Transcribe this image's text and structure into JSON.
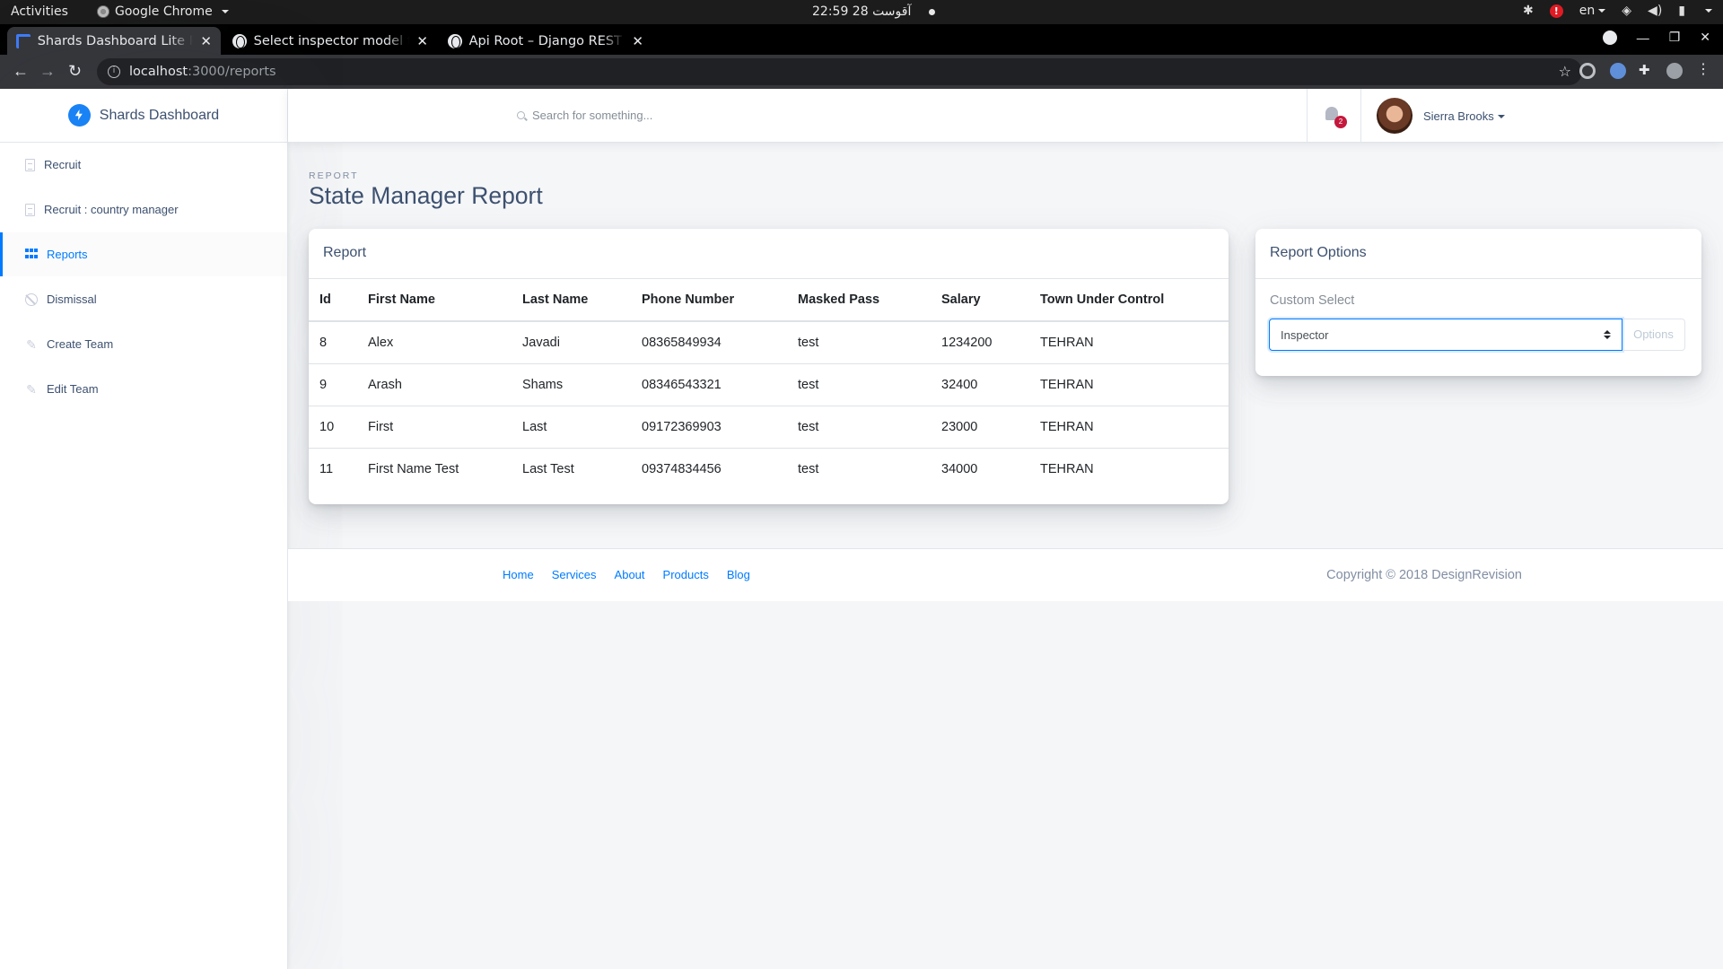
{
  "os": {
    "activities": "Activities",
    "app_name": "Google Chrome",
    "clock": "22:59  28 آقوست",
    "lang": "en"
  },
  "browser": {
    "tabs": [
      {
        "title": "Shards Dashboard Lite Re",
        "active": true
      },
      {
        "title": "Select inspector model to",
        "active": false
      },
      {
        "title": "Api Root – Django REST fr",
        "active": false
      }
    ],
    "url_host": "localhost",
    "url_path": ":3000/reports"
  },
  "sidebar": {
    "brand": "Shards Dashboard",
    "items": [
      {
        "label": "Recruit",
        "icon": "document-icon"
      },
      {
        "label": "Recruit : country manager",
        "icon": "document-icon"
      },
      {
        "label": "Reports",
        "icon": "grid-icon",
        "active": true
      },
      {
        "label": "Dismissal",
        "icon": "ban-icon"
      },
      {
        "label": "Create Team",
        "icon": "pencil-icon"
      },
      {
        "label": "Edit Team",
        "icon": "pencil-icon"
      }
    ]
  },
  "topnav": {
    "search_placeholder": "Search for something...",
    "notification_count": "2",
    "user_name": "Sierra Brooks"
  },
  "page": {
    "subtitle": "Report",
    "title": "State Manager Report"
  },
  "report": {
    "card_title": "Report",
    "columns": [
      "Id",
      "First Name",
      "Last Name",
      "Phone Number",
      "Masked Pass",
      "Salary",
      "Town Under Control"
    ],
    "rows": [
      [
        "8",
        "Alex",
        "Javadi",
        "08365849934",
        "test",
        "1234200",
        "TEHRAN"
      ],
      [
        "9",
        "Arash",
        "Shams",
        "08346543321",
        "test",
        "32400",
        "TEHRAN"
      ],
      [
        "10",
        "First",
        "Last",
        "09172369903",
        "test",
        "23000",
        "TEHRAN"
      ],
      [
        "11",
        "First Name Test",
        "Last Test",
        "09374834456",
        "test",
        "34000",
        "TEHRAN"
      ]
    ]
  },
  "options": {
    "card_title": "Report Options",
    "label": "Custom Select",
    "selected": "Inspector",
    "button": "Options"
  },
  "footer": {
    "links": [
      "Home",
      "Services",
      "About",
      "Products",
      "Blog"
    ],
    "copyright": "Copyright © 2018 DesignRevision"
  },
  "colors": {
    "accent": "#007bff",
    "text": "#3d5170",
    "badge": "#c4183c"
  }
}
